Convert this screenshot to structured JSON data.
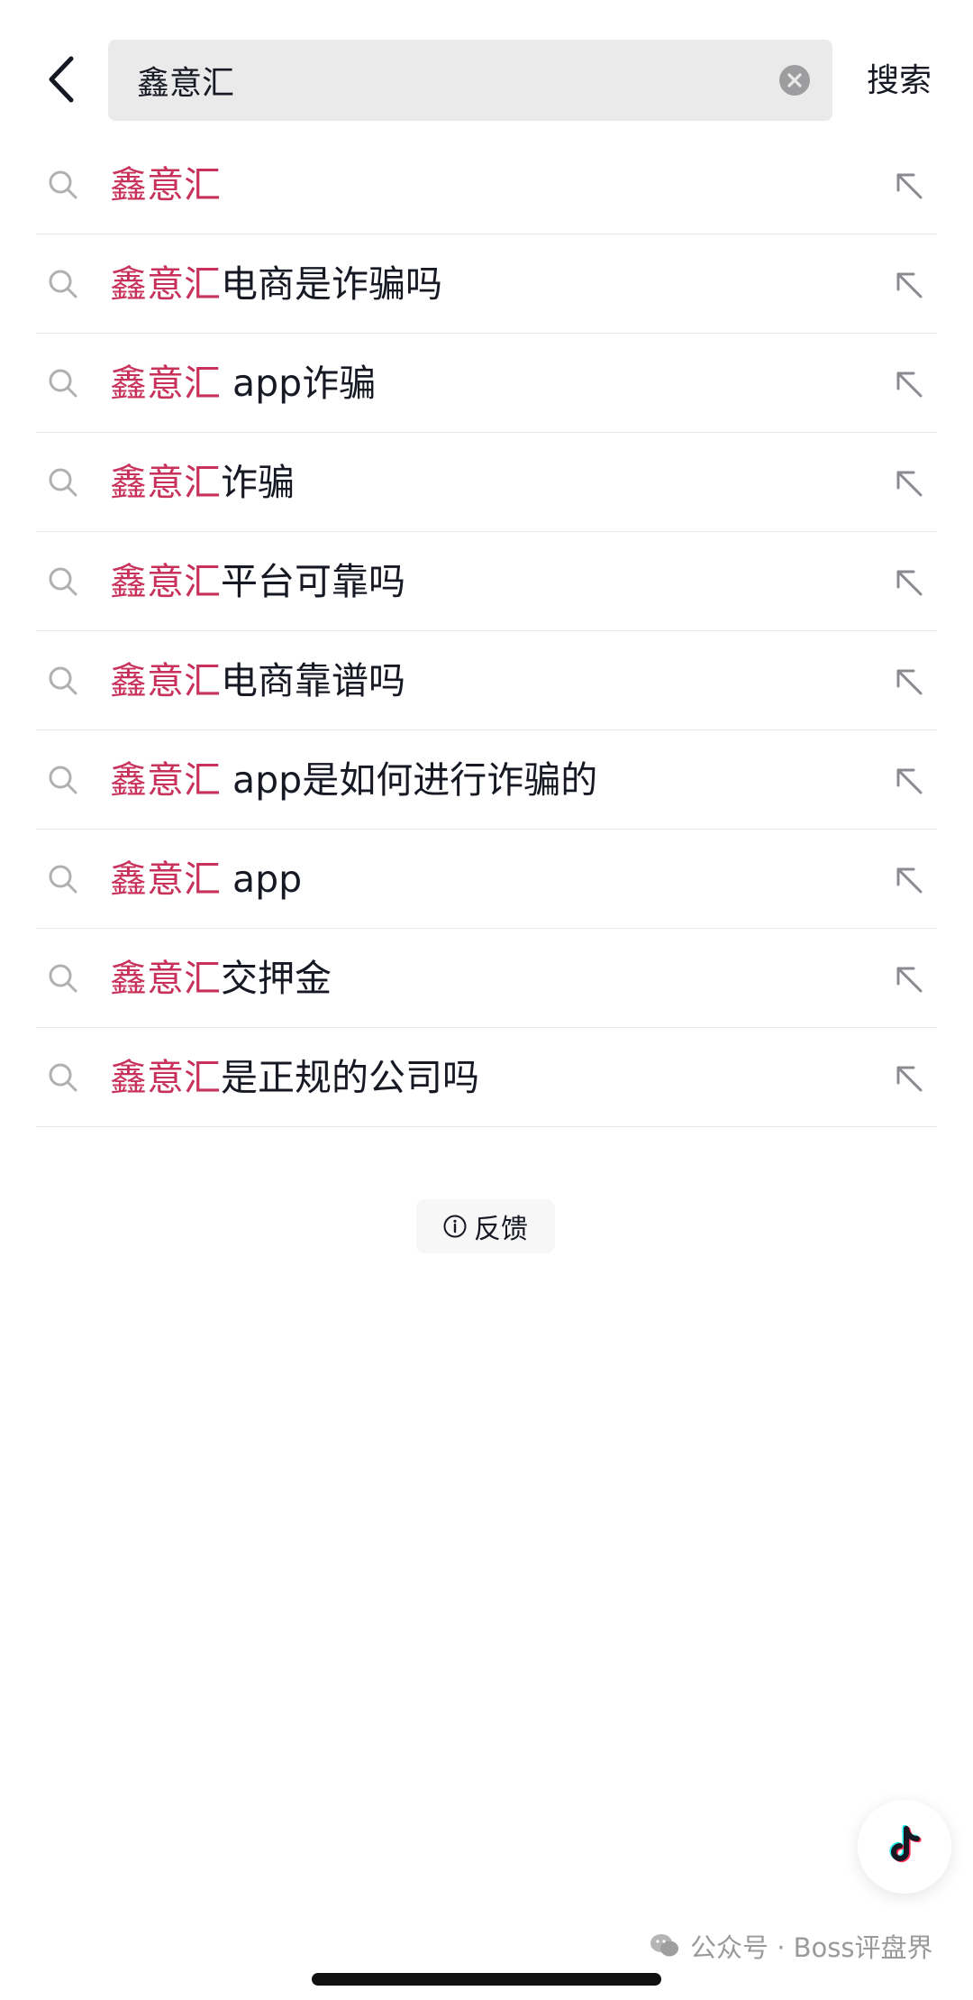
{
  "header": {
    "query": "鑫意汇",
    "search_label": "搜索"
  },
  "highlight_color": "#c8315a",
  "suggestions": [
    {
      "highlight": "鑫意汇",
      "rest": ""
    },
    {
      "highlight": "鑫意汇",
      "rest": "电商是诈骗吗"
    },
    {
      "highlight": "鑫意汇",
      "rest": " app诈骗"
    },
    {
      "highlight": "鑫意汇",
      "rest": "诈骗"
    },
    {
      "highlight": "鑫意汇",
      "rest": "平台可靠吗"
    },
    {
      "highlight": "鑫意汇",
      "rest": "电商靠谱吗"
    },
    {
      "highlight": "鑫意汇",
      "rest": " app是如何进行诈骗的"
    },
    {
      "highlight": "鑫意汇",
      "rest": " app"
    },
    {
      "highlight": "鑫意汇",
      "rest": "交押金"
    },
    {
      "highlight": "鑫意汇",
      "rest": "是正规的公司吗"
    }
  ],
  "feedback_label": "反馈",
  "watermark": "公众号 · Boss评盘界",
  "icons": {
    "back": "chevron-left-icon",
    "clear": "clear-circle-icon",
    "search": "search-icon",
    "fill": "arrow-up-left-icon",
    "info": "info-icon",
    "fab": "tiktok-logo-icon",
    "wechat": "wechat-icon"
  }
}
